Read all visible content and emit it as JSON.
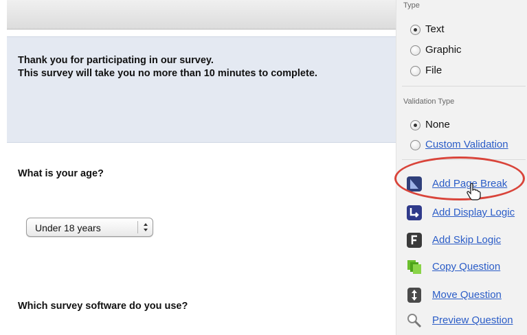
{
  "survey": {
    "intro_line1": "Thank you for participating in our survey.",
    "intro_line2": "This survey will take you no more than 10 minutes to complete.",
    "question1": "What is your age?",
    "age_select_value": "Under 18 years",
    "question2": "Which survey software do you use?"
  },
  "sidebar": {
    "type_label": "Type",
    "type_options": [
      {
        "label": "Text",
        "selected": true
      },
      {
        "label": "Graphic",
        "selected": false
      },
      {
        "label": "File",
        "selected": false
      }
    ],
    "validation_label": "Validation Type",
    "validation_options": [
      {
        "label": "None",
        "selected": true
      },
      {
        "label": "Custom Validation",
        "selected": false
      }
    ],
    "actions": [
      {
        "label": "Add Page Break",
        "icon": "page-break-icon"
      },
      {
        "label": "Add Display Logic",
        "icon": "display-logic-icon"
      },
      {
        "label": "Add Skip Logic",
        "icon": "skip-logic-icon"
      },
      {
        "label": "Copy Question",
        "icon": "copy-icon"
      },
      {
        "label": "Move Question",
        "icon": "move-icon"
      },
      {
        "label": "Preview Question",
        "icon": "magnifier-icon"
      }
    ]
  },
  "colors": {
    "link": "#2a5cc7",
    "highlight": "#d9443a",
    "intro_bg": "#e4e9f2"
  }
}
